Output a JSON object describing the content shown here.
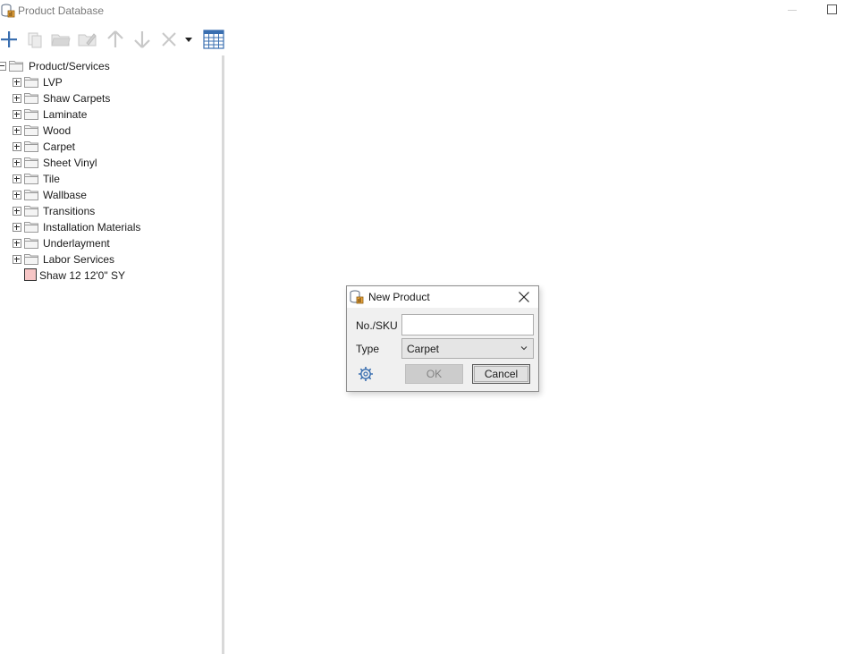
{
  "window": {
    "title": "Product Database"
  },
  "toolbar": {
    "buttons": [
      {
        "icon": "plus-icon",
        "enabled": true
      },
      {
        "icon": "copy-icon",
        "enabled": false
      },
      {
        "icon": "open-folder-icon",
        "enabled": false
      },
      {
        "icon": "edit-folder-icon",
        "enabled": false
      },
      {
        "icon": "arrow-up-icon",
        "enabled": false
      },
      {
        "icon": "arrow-down-icon",
        "enabled": false
      },
      {
        "icon": "delete-icon",
        "enabled": false
      },
      {
        "icon": "dropdown-arrow-icon",
        "enabled": true
      },
      {
        "icon": "grid-icon",
        "enabled": true
      }
    ]
  },
  "tree": {
    "root": "Product/Services",
    "folders": [
      "LVP",
      "Shaw Carpets",
      "Laminate",
      "Wood",
      "Carpet",
      "Sheet Vinyl",
      "Tile",
      "Wallbase",
      "Transitions",
      "Installation Materials",
      "Underlayment",
      "Labor Services"
    ],
    "product": {
      "label": "Shaw 12 12'0\" SY",
      "swatch_color": "#f7c6c6"
    }
  },
  "dialog": {
    "title": "New Product",
    "sku_label": "No./SKU",
    "sku_value": "",
    "type_label": "Type",
    "type_value": "Carpet",
    "ok_label": "OK",
    "cancel_label": "Cancel"
  },
  "colors": {
    "accent": "#3a6fb0",
    "disabled_icon": "#c8c8c8"
  }
}
